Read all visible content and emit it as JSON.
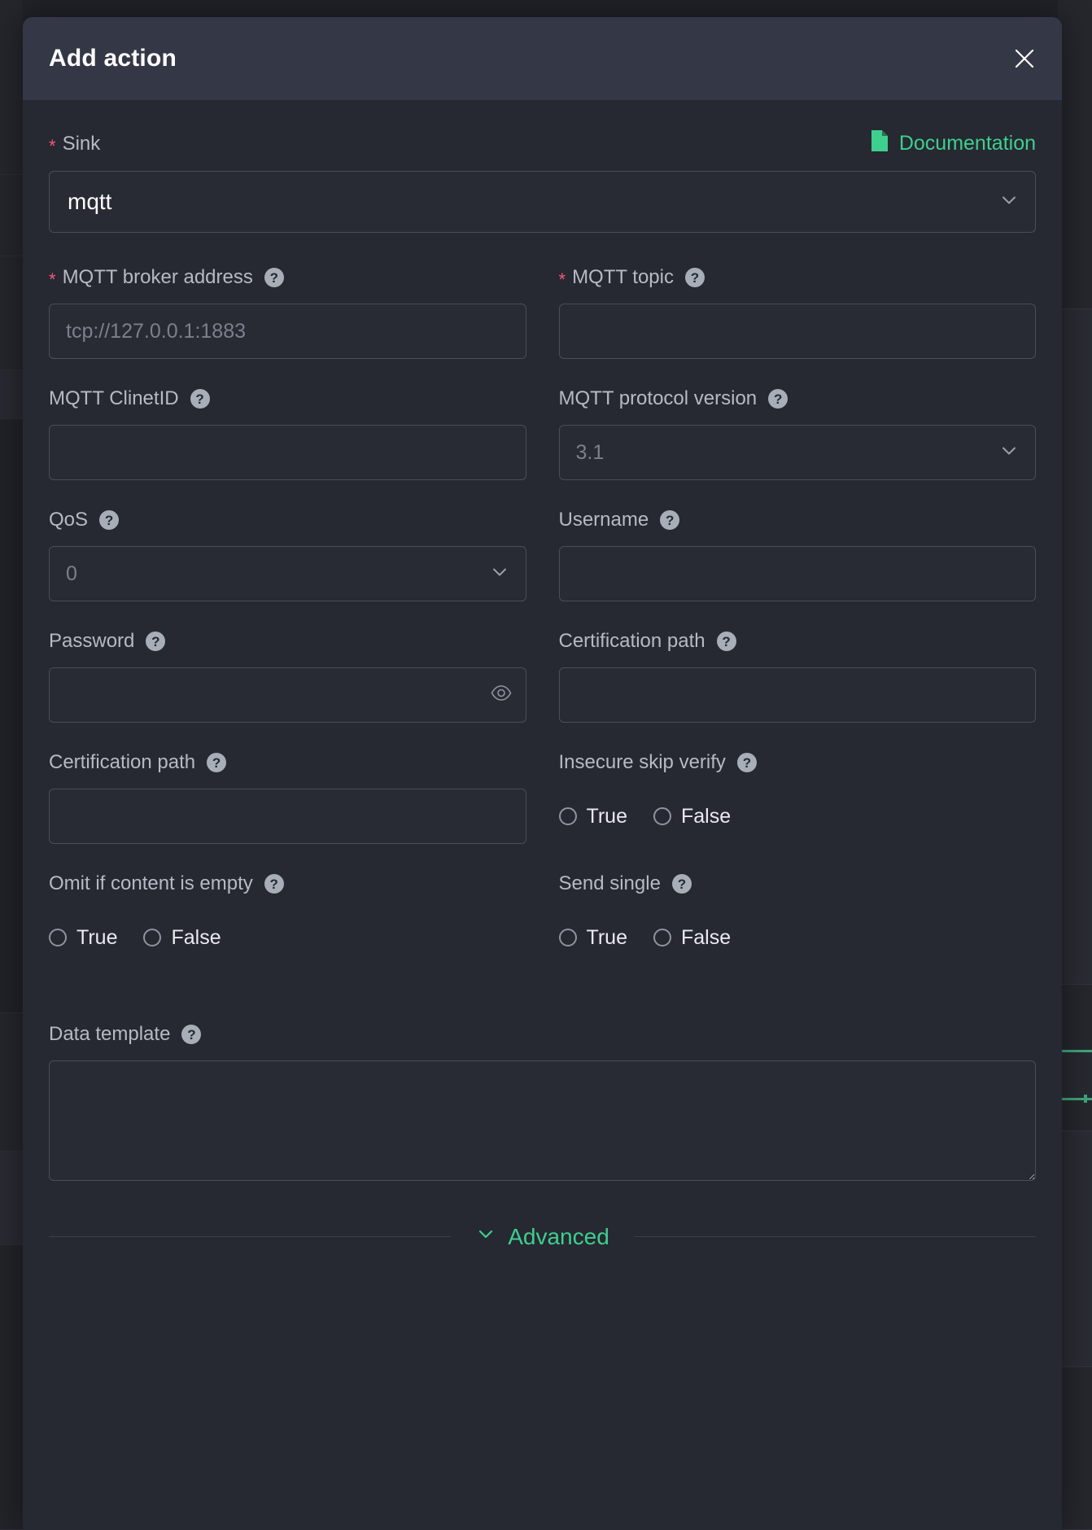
{
  "backdrop": {
    "accent_green": "#3fa57b"
  },
  "modal": {
    "title": "Add action",
    "close_icon": "close-icon",
    "sink": {
      "label": "Sink",
      "required": true,
      "required_marker": "*",
      "value": "mqtt",
      "chevron_icon": "chevron-down-icon",
      "documentation": {
        "label": "Documentation",
        "icon": "document-icon",
        "color": "#3ecf8e"
      }
    },
    "fields": [
      {
        "name": "mqtt-broker-address",
        "label": "MQTT broker address",
        "required": true,
        "required_marker": "*",
        "type": "text",
        "value": "",
        "placeholder": "tcp://127.0.0.1:1883",
        "help_icon": "help-icon"
      },
      {
        "name": "mqtt-topic",
        "label": "MQTT topic",
        "required": true,
        "required_marker": "*",
        "type": "text",
        "value": "",
        "placeholder": "",
        "help_icon": "help-icon"
      },
      {
        "name": "mqtt-clinetid",
        "label": "MQTT ClinetID",
        "required": false,
        "type": "text",
        "value": "",
        "placeholder": "",
        "help_icon": "help-icon"
      },
      {
        "name": "mqtt-protocol-version",
        "label": "MQTT protocol version",
        "required": false,
        "type": "select",
        "value": "",
        "placeholder": "3.1",
        "help_icon": "help-icon",
        "chevron_icon": "chevron-down-icon"
      },
      {
        "name": "qos",
        "label": "QoS",
        "required": false,
        "type": "select",
        "value": "",
        "placeholder": "0",
        "help_icon": "help-icon",
        "chevron_icon": "chevron-down-icon"
      },
      {
        "name": "username",
        "label": "Username",
        "required": false,
        "type": "text",
        "value": "",
        "placeholder": "",
        "help_icon": "help-icon"
      },
      {
        "name": "password",
        "label": "Password",
        "required": false,
        "type": "password",
        "value": "",
        "placeholder": "",
        "help_icon": "help-icon",
        "reveal_icon": "eye-icon"
      },
      {
        "name": "certification-path-1",
        "label": "Certification path",
        "required": false,
        "type": "text",
        "value": "",
        "placeholder": "",
        "help_icon": "help-icon"
      },
      {
        "name": "certification-path-2",
        "label": "Certification path",
        "required": false,
        "type": "text",
        "value": "",
        "placeholder": "",
        "help_icon": "help-icon"
      },
      {
        "name": "insecure-skip-verify",
        "label": "Insecure skip verify",
        "required": false,
        "type": "radio",
        "options": [
          "True",
          "False"
        ],
        "selected": null,
        "help_icon": "help-icon"
      },
      {
        "name": "omit-if-content-is-empty",
        "label": "Omit if content is empty",
        "required": false,
        "type": "radio",
        "options": [
          "True",
          "False"
        ],
        "selected": null,
        "help_icon": "help-icon"
      },
      {
        "name": "send-single",
        "label": "Send single",
        "required": false,
        "type": "radio",
        "options": [
          "True",
          "False"
        ],
        "selected": null,
        "help_icon": "help-icon"
      },
      {
        "name": "data-template",
        "label": "Data template",
        "required": false,
        "type": "textarea",
        "value": "",
        "placeholder": "",
        "help_icon": "help-icon"
      }
    ],
    "advanced": {
      "label": "Advanced",
      "icon": "chevron-down-icon",
      "color": "#3ecf8e"
    }
  }
}
